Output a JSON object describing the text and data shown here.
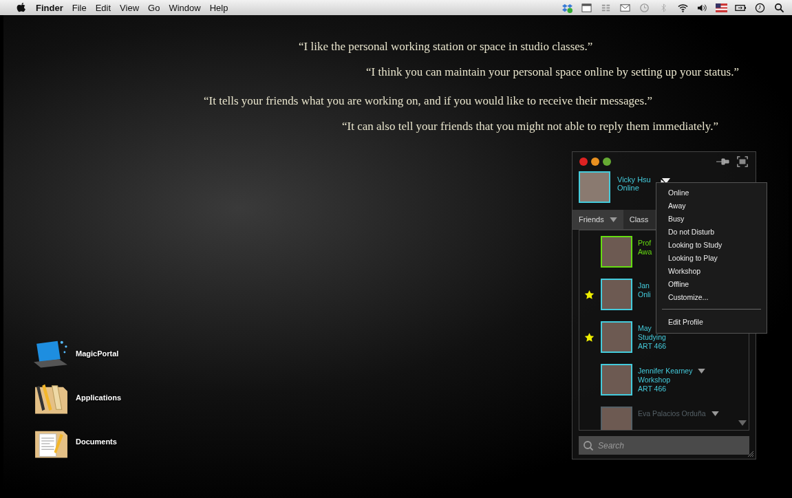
{
  "menu_bar": {
    "items": [
      "Finder",
      "File",
      "Edit",
      "View",
      "Go",
      "Window",
      "Help"
    ]
  },
  "quotes": [
    "“I like the personal working station or space in studio classes.”",
    "“I think you can maintain your personal space online by setting up your status.”",
    "“It tells your friends what you are working on, and if you would like to receive their messages.”",
    "“It can also tell your friends that you might not able to reply them immediately.”"
  ],
  "desktop_icons": [
    {
      "label": "MagicPortal",
      "kind": "portal"
    },
    {
      "label": "Applications",
      "kind": "apps"
    },
    {
      "label": "Documents",
      "kind": "docs"
    }
  ],
  "chat": {
    "user": {
      "name": "Vicky Hsu",
      "status": "Online"
    },
    "tabs": [
      {
        "label": "Friends",
        "selected": true
      },
      {
        "label": "Class",
        "selected": false
      }
    ],
    "friends": [
      {
        "name": "Prof",
        "status": "Awa",
        "starred": false,
        "color": "#66dd11"
      },
      {
        "name": "Jan",
        "status": "Onli",
        "starred": true,
        "color": "#44ccdd"
      },
      {
        "name": "May",
        "status": "Studying",
        "course": "ART 466",
        "starred": true,
        "color": "#44ccdd"
      },
      {
        "name": "Jennifer Kearney",
        "status": "Workshop",
        "course": "ART 466",
        "starred": false,
        "color": "#44ccdd",
        "caret": true
      },
      {
        "name": "Eva Palacios Orduña",
        "starred": false,
        "color": "#556066",
        "caret": true
      }
    ],
    "search": {
      "placeholder": "Search"
    },
    "status_menu": {
      "items": [
        "Online",
        "Away",
        "Busy",
        "Do not Disturb",
        "Looking to Study",
        "Looking to Play",
        "Workshop",
        "Offline",
        "Customize..."
      ],
      "footer": "Edit Profile"
    }
  }
}
